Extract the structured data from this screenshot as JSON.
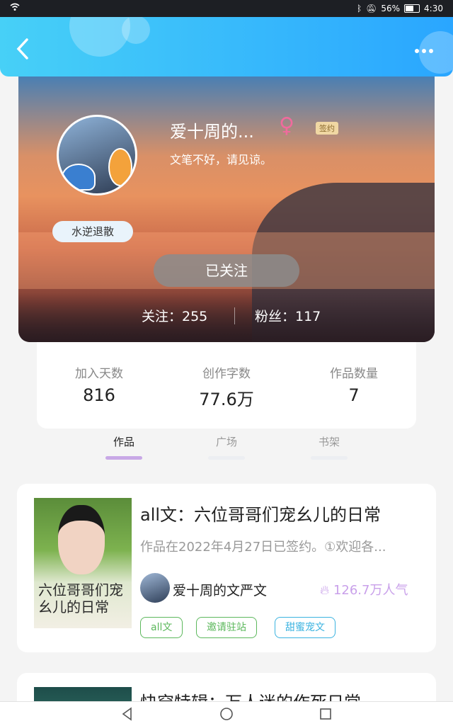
{
  "status_bar": {
    "battery": "56%",
    "time": "4:30",
    "battery_level": 0.56
  },
  "profile": {
    "nickname": "爱十周的...",
    "gender_icon": "♀",
    "sign_badge": "签约",
    "motto": "文笔不好，请见谅。",
    "badge": "水逆退散",
    "follow_button": "已关注",
    "following": "关注：255",
    "fans": "粉丝：117"
  },
  "stats": [
    {
      "label": "加入天数",
      "value": "816"
    },
    {
      "label": "创作字数",
      "value": "77.6万"
    },
    {
      "label": "作品数量",
      "value": "7"
    }
  ],
  "tabs": [
    "作品",
    "广场",
    "书架"
  ],
  "works": [
    {
      "cover_title": "六位哥哥们宠幺儿的日常",
      "title": "all文：六位哥哥们宠幺儿的日常",
      "description": "作品在2022年4月27日已签约。①欢迎各...",
      "author": "爱十周的文严文",
      "popularity": "126.7万人气",
      "tags": [
        {
          "label": "all文",
          "color": "#5cb85c"
        },
        {
          "label": "邀请驻站",
          "color": "#5cb85c"
        },
        {
          "label": "甜蜜宠文",
          "color": "#3bb3e0"
        }
      ]
    },
    {
      "title": "快穿特辑：万人迷的作死日常"
    }
  ],
  "colors": {
    "header": "#2aa6ff",
    "accent": "#c8a8e6"
  }
}
